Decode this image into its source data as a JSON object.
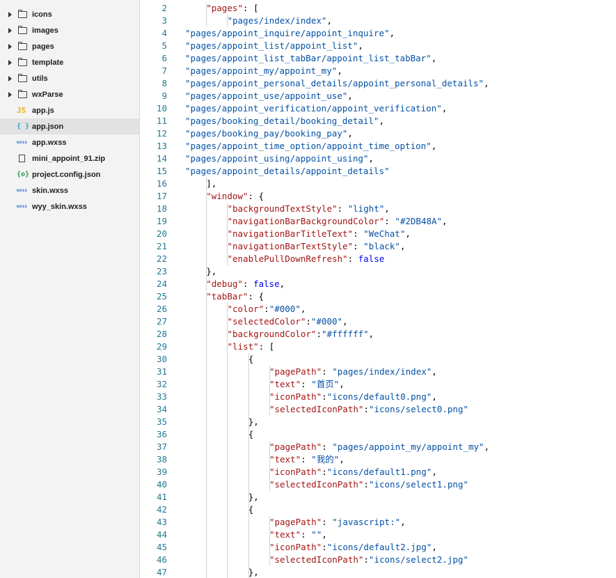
{
  "explorer": {
    "items": [
      {
        "type": "folder",
        "label": "icons",
        "icon": "folder-icon"
      },
      {
        "type": "folder",
        "label": "images",
        "icon": "folder-icon"
      },
      {
        "type": "folder",
        "label": "pages",
        "icon": "folder-icon"
      },
      {
        "type": "folder",
        "label": "template",
        "icon": "folder-icon"
      },
      {
        "type": "folder",
        "label": "utils",
        "icon": "folder-icon"
      },
      {
        "type": "folder",
        "label": "wxParse",
        "icon": "folder-icon"
      },
      {
        "type": "file",
        "label": "app.js",
        "icon": "js-file-icon",
        "glyph": "JS"
      },
      {
        "type": "file",
        "label": "app.json",
        "icon": "json-file-icon",
        "glyph": "{ }",
        "selected": true
      },
      {
        "type": "file",
        "label": "app.wxss",
        "icon": "wxss-file-icon",
        "glyph": "wxss"
      },
      {
        "type": "file",
        "label": "mini_appoint_91.zip",
        "icon": "zip-file-icon",
        "glyph": ""
      },
      {
        "type": "file",
        "label": "project.config.json",
        "icon": "config-file-icon",
        "glyph": "{o}"
      },
      {
        "type": "file",
        "label": "skin.wxss",
        "icon": "wxss-file-icon",
        "glyph": "wxss"
      },
      {
        "type": "file",
        "label": "wyy_skin.wxss",
        "icon": "wxss-file-icon",
        "glyph": "wxss"
      }
    ]
  },
  "editor": {
    "lines": [
      {
        "n": "2",
        "indent": 2,
        "t": [
          [
            "k",
            "\"pages\""
          ],
          [
            "p",
            ": ["
          ]
        ]
      },
      {
        "n": "3",
        "indent": 3,
        "t": [
          [
            "s",
            "\"pages/index/index\""
          ],
          [
            "p",
            ","
          ]
        ]
      },
      {
        "n": "4",
        "indent": 0,
        "t": [
          [
            "s",
            "\"pages/appoint_inquire/appoint_inquire\""
          ],
          [
            "p",
            ","
          ]
        ]
      },
      {
        "n": "5",
        "indent": 0,
        "t": [
          [
            "s",
            "\"pages/appoint_list/appoint_list\""
          ],
          [
            "p",
            ","
          ]
        ]
      },
      {
        "n": "6",
        "indent": 0,
        "t": [
          [
            "s",
            "\"pages/appoint_list_tabBar/appoint_list_tabBar\""
          ],
          [
            "p",
            ","
          ]
        ]
      },
      {
        "n": "7",
        "indent": 0,
        "t": [
          [
            "s",
            "\"pages/appoint_my/appoint_my\""
          ],
          [
            "p",
            ","
          ]
        ]
      },
      {
        "n": "8",
        "indent": 0,
        "t": [
          [
            "s",
            "\"pages/appoint_personal_details/appoint_personal_details\""
          ],
          [
            "p",
            ","
          ]
        ]
      },
      {
        "n": "9",
        "indent": 0,
        "t": [
          [
            "s",
            "\"pages/appoint_use/appoint_use\""
          ],
          [
            "p",
            ","
          ]
        ]
      },
      {
        "n": "10",
        "indent": 0,
        "t": [
          [
            "s",
            "\"pages/appoint_verification/appoint_verification\""
          ],
          [
            "p",
            ","
          ]
        ]
      },
      {
        "n": "11",
        "indent": 0,
        "t": [
          [
            "s",
            "\"pages/booking_detail/booking_detail\""
          ],
          [
            "p",
            ","
          ]
        ]
      },
      {
        "n": "12",
        "indent": 0,
        "t": [
          [
            "s",
            "\"pages/booking_pay/booking_pay\""
          ],
          [
            "p",
            ","
          ]
        ]
      },
      {
        "n": "13",
        "indent": 0,
        "t": [
          [
            "s",
            "\"pages/appoint_time_option/appoint_time_option\""
          ],
          [
            "p",
            ","
          ]
        ]
      },
      {
        "n": "14",
        "indent": 0,
        "t": [
          [
            "s",
            "\"pages/appoint_using/appoint_using\""
          ],
          [
            "p",
            ","
          ]
        ]
      },
      {
        "n": "15",
        "indent": 0,
        "t": [
          [
            "s",
            "\"pages/appoint_details/appoint_details\""
          ]
        ]
      },
      {
        "n": "16",
        "indent": 2,
        "t": [
          [
            "p",
            "],"
          ]
        ]
      },
      {
        "n": "17",
        "indent": 2,
        "t": [
          [
            "k",
            "\"window\""
          ],
          [
            "p",
            ": {"
          ]
        ]
      },
      {
        "n": "18",
        "indent": 3,
        "t": [
          [
            "k",
            "\"backgroundTextStyle\""
          ],
          [
            "p",
            ": "
          ],
          [
            "s",
            "\"light\""
          ],
          [
            "p",
            ","
          ]
        ]
      },
      {
        "n": "19",
        "indent": 3,
        "t": [
          [
            "k",
            "\"navigationBarBackgroundColor\""
          ],
          [
            "p",
            ": "
          ],
          [
            "s",
            "\"#2DB48A\""
          ],
          [
            "p",
            ","
          ]
        ]
      },
      {
        "n": "20",
        "indent": 3,
        "t": [
          [
            "k",
            "\"navigationBarTitleText\""
          ],
          [
            "p",
            ": "
          ],
          [
            "s",
            "\"WeChat\""
          ],
          [
            "p",
            ","
          ]
        ]
      },
      {
        "n": "21",
        "indent": 3,
        "t": [
          [
            "k",
            "\"navigationBarTextStyle\""
          ],
          [
            "p",
            ": "
          ],
          [
            "s",
            "\"black\""
          ],
          [
            "p",
            ","
          ]
        ]
      },
      {
        "n": "22",
        "indent": 3,
        "t": [
          [
            "k",
            "\"enablePullDownRefresh\""
          ],
          [
            "p",
            ": "
          ],
          [
            "v",
            "false"
          ]
        ]
      },
      {
        "n": "23",
        "indent": 2,
        "t": [
          [
            "p",
            "},"
          ]
        ]
      },
      {
        "n": "24",
        "indent": 2,
        "t": [
          [
            "k",
            "\"debug\""
          ],
          [
            "p",
            ": "
          ],
          [
            "v",
            "false"
          ],
          [
            "p",
            ","
          ]
        ]
      },
      {
        "n": "25",
        "indent": 2,
        "t": [
          [
            "k",
            "\"tabBar\""
          ],
          [
            "p",
            ": {"
          ]
        ]
      },
      {
        "n": "26",
        "indent": 3,
        "t": [
          [
            "k",
            "\"color\""
          ],
          [
            "p",
            ":"
          ],
          [
            "s",
            "\"#000\""
          ],
          [
            "p",
            ","
          ]
        ]
      },
      {
        "n": "27",
        "indent": 3,
        "t": [
          [
            "k",
            "\"selectedColor\""
          ],
          [
            "p",
            ":"
          ],
          [
            "s",
            "\"#000\""
          ],
          [
            "p",
            ","
          ]
        ]
      },
      {
        "n": "28",
        "indent": 3,
        "t": [
          [
            "k",
            "\"backgroundColor\""
          ],
          [
            "p",
            ":"
          ],
          [
            "s",
            "\"#ffffff\""
          ],
          [
            "p",
            ","
          ]
        ]
      },
      {
        "n": "29",
        "indent": 3,
        "t": [
          [
            "k",
            "\"list\""
          ],
          [
            "p",
            ": ["
          ]
        ]
      },
      {
        "n": "30",
        "indent": 4,
        "t": [
          [
            "p",
            "{"
          ]
        ]
      },
      {
        "n": "31",
        "indent": 5,
        "t": [
          [
            "k",
            "\"pagePath\""
          ],
          [
            "p",
            ": "
          ],
          [
            "s",
            "\"pages/index/index\""
          ],
          [
            "p",
            ","
          ]
        ]
      },
      {
        "n": "32",
        "indent": 5,
        "t": [
          [
            "k",
            "\"text\""
          ],
          [
            "p",
            ": "
          ],
          [
            "s",
            "\"首页\""
          ],
          [
            "p",
            ","
          ]
        ]
      },
      {
        "n": "33",
        "indent": 5,
        "t": [
          [
            "k",
            "\"iconPath\""
          ],
          [
            "p",
            ":"
          ],
          [
            "s",
            "\"icons/default0.png\""
          ],
          [
            "p",
            ","
          ]
        ]
      },
      {
        "n": "34",
        "indent": 5,
        "t": [
          [
            "k",
            "\"selectedIconPath\""
          ],
          [
            "p",
            ":"
          ],
          [
            "s",
            "\"icons/select0.png\""
          ]
        ]
      },
      {
        "n": "35",
        "indent": 4,
        "t": [
          [
            "p",
            "},"
          ]
        ]
      },
      {
        "n": "36",
        "indent": 4,
        "t": [
          [
            "p",
            "{"
          ]
        ]
      },
      {
        "n": "37",
        "indent": 5,
        "t": [
          [
            "k",
            "\"pagePath\""
          ],
          [
            "p",
            ": "
          ],
          [
            "s",
            "\"pages/appoint_my/appoint_my\""
          ],
          [
            "p",
            ","
          ]
        ]
      },
      {
        "n": "38",
        "indent": 5,
        "t": [
          [
            "k",
            "\"text\""
          ],
          [
            "p",
            ": "
          ],
          [
            "s",
            "\"我的\""
          ],
          [
            "p",
            ","
          ]
        ]
      },
      {
        "n": "39",
        "indent": 5,
        "t": [
          [
            "k",
            "\"iconPath\""
          ],
          [
            "p",
            ":"
          ],
          [
            "s",
            "\"icons/default1.png\""
          ],
          [
            "p",
            ","
          ]
        ]
      },
      {
        "n": "40",
        "indent": 5,
        "t": [
          [
            "k",
            "\"selectedIconPath\""
          ],
          [
            "p",
            ":"
          ],
          [
            "s",
            "\"icons/select1.png\""
          ]
        ]
      },
      {
        "n": "41",
        "indent": 4,
        "t": [
          [
            "p",
            "},"
          ]
        ]
      },
      {
        "n": "42",
        "indent": 4,
        "t": [
          [
            "p",
            "{"
          ]
        ]
      },
      {
        "n": "43",
        "indent": 5,
        "t": [
          [
            "k",
            "\"pagePath\""
          ],
          [
            "p",
            ": "
          ],
          [
            "s",
            "\"javascript:\""
          ],
          [
            "p",
            ","
          ]
        ]
      },
      {
        "n": "44",
        "indent": 5,
        "t": [
          [
            "k",
            "\"text\""
          ],
          [
            "p",
            ": "
          ],
          [
            "s",
            "\"\""
          ],
          [
            "p",
            ","
          ]
        ]
      },
      {
        "n": "45",
        "indent": 5,
        "t": [
          [
            "k",
            "\"iconPath\""
          ],
          [
            "p",
            ":"
          ],
          [
            "s",
            "\"icons/default2.jpg\""
          ],
          [
            "p",
            ","
          ]
        ]
      },
      {
        "n": "46",
        "indent": 5,
        "t": [
          [
            "k",
            "\"selectedIconPath\""
          ],
          [
            "p",
            ":"
          ],
          [
            "s",
            "\"icons/select2.jpg\""
          ]
        ]
      },
      {
        "n": "47",
        "indent": 4,
        "t": [
          [
            "p",
            "},"
          ]
        ]
      }
    ]
  }
}
